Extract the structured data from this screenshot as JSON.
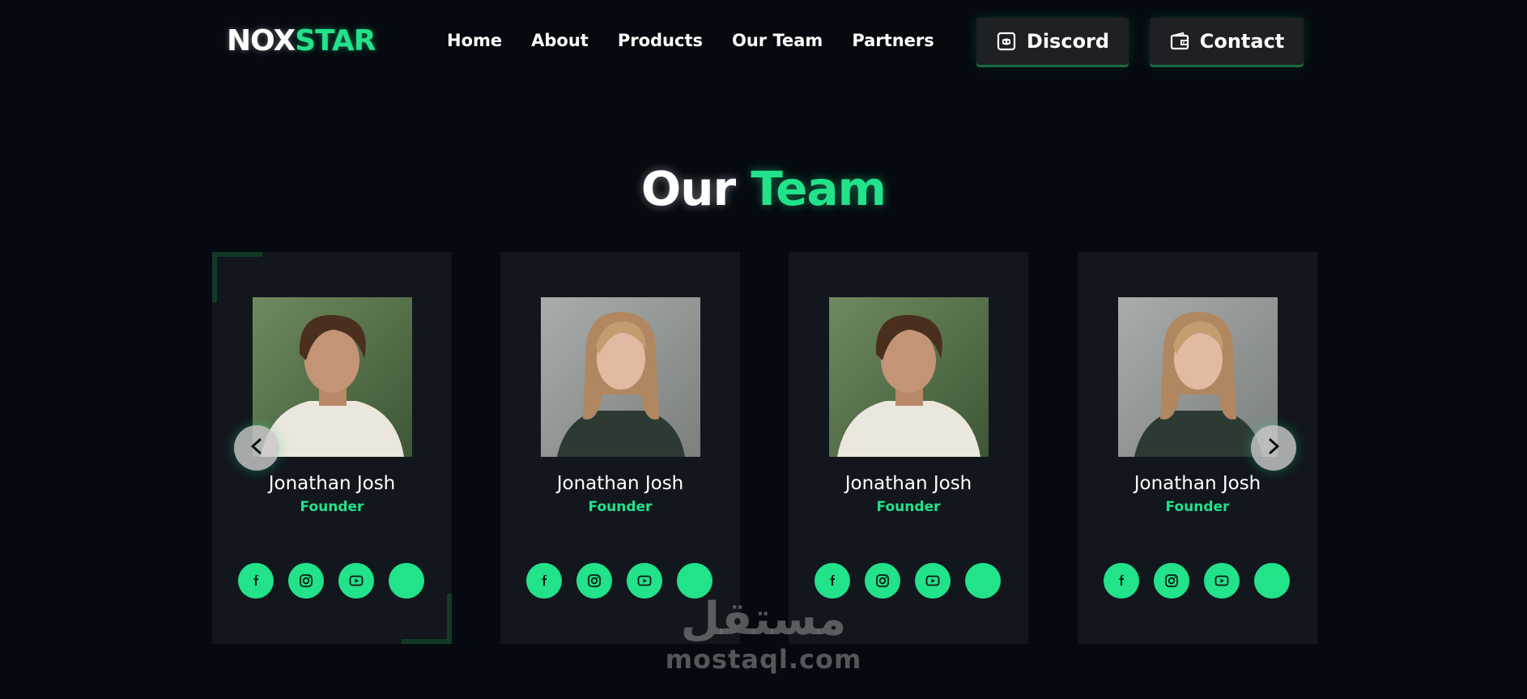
{
  "brand": {
    "logo_part1": "NOX",
    "logo_part2": "STAR",
    "accent_color": "#22e28a"
  },
  "nav": {
    "items": [
      "Home",
      "About",
      "Products",
      "Our Team",
      "Partners"
    ]
  },
  "header_buttons": {
    "discord_label": "Discord",
    "contact_label": "Contact"
  },
  "section": {
    "title_part1": "Our",
    "title_part2": "Team"
  },
  "team": {
    "members": [
      {
        "name": "Jonathan Josh",
        "role": "Founder",
        "photo": "male"
      },
      {
        "name": "Jonathan Josh",
        "role": "Founder",
        "photo": "female"
      },
      {
        "name": "Jonathan Josh",
        "role": "Founder",
        "photo": "male"
      },
      {
        "name": "Jonathan Josh",
        "role": "Founder",
        "photo": "female"
      }
    ],
    "social_icons": [
      "facebook-icon",
      "instagram-icon",
      "youtube-icon",
      "blank-icon"
    ]
  },
  "slider": {
    "prev_icon": "chevron-left-icon",
    "next_icon": "chevron-right-icon"
  },
  "watermark": {
    "arabic": "مستقل",
    "latin": "mostaql.com"
  }
}
